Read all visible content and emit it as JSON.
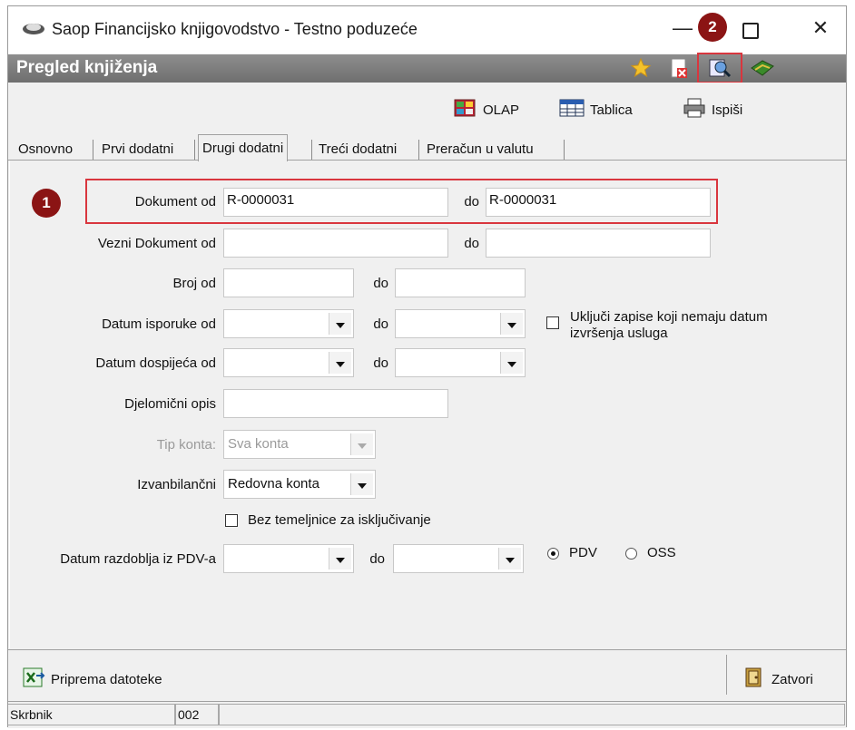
{
  "window": {
    "title": "Saop Financijsko knjigovodstvo - Testno poduzeće",
    "minimize": "—",
    "close": "✕"
  },
  "header": {
    "title": "Pregled knjiženja"
  },
  "toolbar": {
    "olap": "OLAP",
    "tablica": "Tablica",
    "ispisi": "Ispiši"
  },
  "tabs": [
    {
      "label": "Osnovno"
    },
    {
      "label": "Prvi dodatni"
    },
    {
      "label": "Drugi dodatni"
    },
    {
      "label": "Treći dodatni"
    },
    {
      "label": "Preračun u valutu"
    }
  ],
  "active_tab": "Drugi dodatni",
  "badges": {
    "one": "1",
    "two": "2"
  },
  "form": {
    "dokument_od_label": "Dokument od",
    "dokument_od_value": "R-0000031",
    "dokument_do_label": "do",
    "dokument_do_value": "R-0000031",
    "vezni_label": "Vezni Dokument od",
    "vezni_do_label": "do",
    "broj_label": "Broj od",
    "broj_do_label": "do",
    "datum_isporuke_label": "Datum isporuke od",
    "datum_isporuke_do_label": "do",
    "ukljuci_label": "Uključi zapise koji nemaju datum izvršenja usluga",
    "datum_dospijeca_label": "Datum dospijeća od",
    "datum_dospijeca_do_label": "do",
    "opis_label": "Djelomični opis",
    "tip_konta_label": "Tip konta:",
    "tip_konta_value": "Sva konta",
    "izvanbilancni_label": "Izvanbilančni",
    "izvanbilancni_value": "Redovna konta",
    "bez_temeljnice_label": "Bez temeljnice za isključivanje",
    "pdv_label": "Datum razdoblja iz PDV-a",
    "pdv_do_label": "do",
    "radio_pdv": "PDV",
    "radio_oss": "OSS",
    "radio_selected": "PDV"
  },
  "bottom": {
    "priprema": "Priprema datoteke",
    "zatvori": "Zatvori"
  },
  "status": {
    "user": "Skrbnik",
    "code": "002"
  },
  "colors": {
    "header_gray": "#7a7a7a",
    "highlight_red": "#d9363e",
    "badge_red": "#8b1414"
  }
}
